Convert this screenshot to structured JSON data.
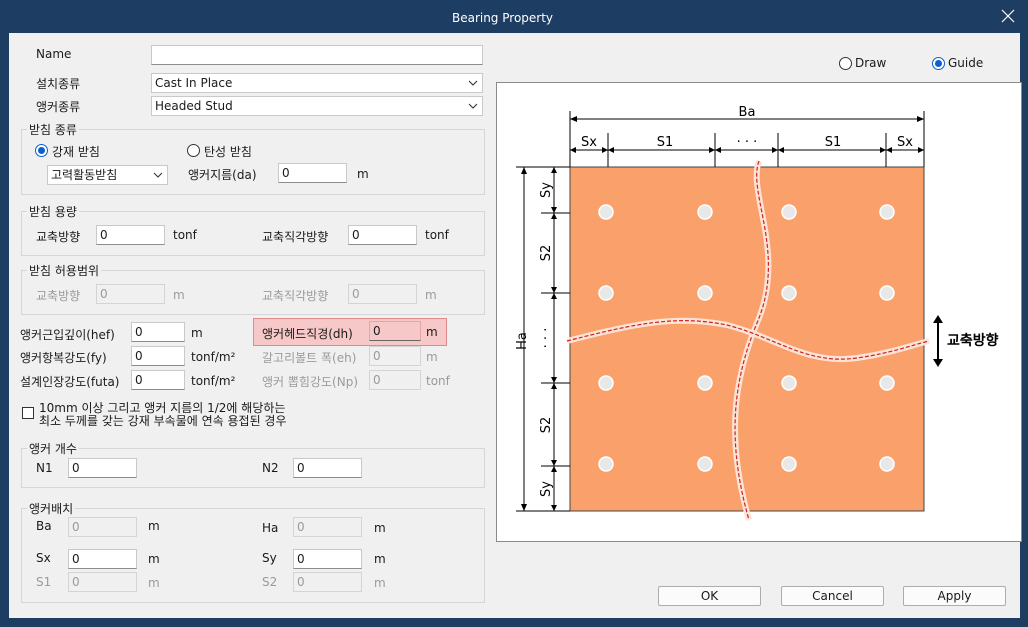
{
  "window": {
    "title": "Bearing Property"
  },
  "form": {
    "name": {
      "label": "Name",
      "value": ""
    },
    "install_type": {
      "label": "설치종류",
      "value": "Cast In Place"
    },
    "anchor_type": {
      "label": "앵커종류",
      "value": "Headed Stud"
    },
    "bearing_type": {
      "title": "받침 종류",
      "option_steel": "강재 받침",
      "option_elastic": "탄성 받침",
      "selected": "강재 받침",
      "subtype": "고력활동받침",
      "anchor_dia_label": "앵커지름(da)",
      "anchor_dia_value": "0",
      "anchor_dia_unit": "m"
    },
    "capacity": {
      "title": "받침 용량",
      "axial_label": "교축방향",
      "axial_value": "0",
      "axial_unit": "tonf",
      "trans_label": "교축직각방향",
      "trans_value": "0",
      "trans_unit": "tonf"
    },
    "tolerance": {
      "title": "받침 허용범위",
      "axial_label": "교축방향",
      "axial_value": "0",
      "axial_unit": "m",
      "trans_label": "교축직각방향",
      "trans_value": "0",
      "trans_unit": "m"
    },
    "hef": {
      "label": "앵커근입깊이(hef)",
      "value": "0",
      "unit": "m"
    },
    "dh": {
      "label": "앵커헤드직경(dh)",
      "value": "0",
      "unit": "m"
    },
    "fy": {
      "label": "앵커항복강도(fy)",
      "value": "0",
      "unit": "tonf/m²"
    },
    "eh": {
      "label": "갈고리볼트 폭(eh)",
      "value": "0",
      "unit": "m"
    },
    "futa": {
      "label": "설계인장강도(futa)",
      "value": "0",
      "unit": "tonf/m²"
    },
    "np": {
      "label": "앵커 뽑힘강도(Np)",
      "value": "0",
      "unit": "tonf"
    },
    "weld_check": {
      "line1": "10mm 이상 그리고 앵커 지름의 1/2에 해당하는",
      "line2": "최소 두께를 갖는 강재 부속물에 연속 용접된 경우",
      "checked": false
    },
    "anchor_count": {
      "title": "앵커 개수",
      "n1_label": "N1",
      "n1_value": "0",
      "n2_label": "N2",
      "n2_value": "0"
    },
    "anchor_layout": {
      "title": "앵커배치",
      "ba_label": "Ba",
      "ba_value": "0",
      "ba_unit": "m",
      "ha_label": "Ha",
      "ha_value": "0",
      "ha_unit": "m",
      "sx_label": "Sx",
      "sx_value": "0",
      "sx_unit": "m",
      "sy_label": "Sy",
      "sy_value": "0",
      "sy_unit": "m",
      "s1_label": "S1",
      "s1_value": "0",
      "s1_unit": "m",
      "s2_label": "S2",
      "s2_value": "0",
      "s2_unit": "m"
    }
  },
  "preview": {
    "draw_label": "Draw",
    "guide_label": "Guide",
    "selected": "Guide",
    "plate_color": "#f9a06b",
    "crack_color": "#d42020",
    "dim_ba": "Ba",
    "dim_ha": "Ha",
    "dim_sx": "Sx",
    "dim_s1": "S1",
    "dim_sy": "Sy",
    "dim_s2": "S2",
    "dim_dots": "· · ·",
    "direction_label": "교축방향"
  },
  "buttons": {
    "ok": "OK",
    "cancel": "Cancel",
    "apply": "Apply"
  }
}
